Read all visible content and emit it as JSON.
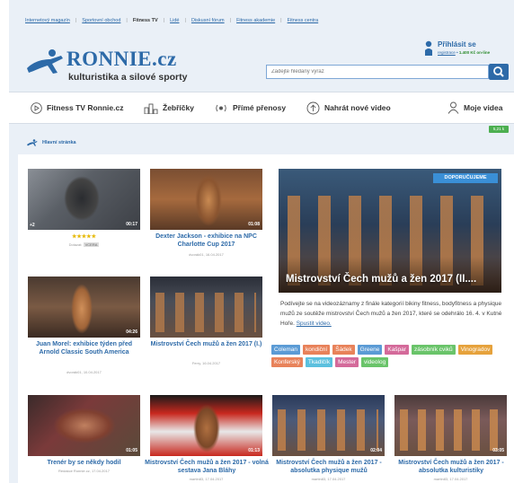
{
  "top_links": [
    {
      "label": "Internetový magazín",
      "active": false
    },
    {
      "label": "Sportovní obchod",
      "active": false
    },
    {
      "label": "Fitness TV",
      "active": true
    },
    {
      "label": "Lidé",
      "active": false
    },
    {
      "label": "Diskusní fórum",
      "active": false
    },
    {
      "label": "Fitness akademie",
      "active": false
    },
    {
      "label": "Fitness centra",
      "active": false
    }
  ],
  "header": {
    "logo_text": "RONNIE.cz",
    "logo_subtitle": "kulturistika a silové sporty",
    "login_title": "Přihlásit se",
    "login_register": "registrace",
    "login_bonus": "1.400 Kč on-line"
  },
  "search": {
    "placeholder": "Zadejte hledaný výraz"
  },
  "nav": {
    "items": [
      {
        "label": "Fitness TV Ronnie.cz",
        "icon": "play-icon"
      },
      {
        "label": "Žebříčky",
        "icon": "ranking-icon"
      },
      {
        "label": "Přímé přenosy",
        "icon": "live-icon"
      },
      {
        "label": "Nahrát nové video",
        "icon": "upload-icon"
      },
      {
        "label": "Moje videa",
        "icon": "user-icon"
      }
    ],
    "badge": "5,21 k"
  },
  "breadcrumb": {
    "label": "Hlavní stránka"
  },
  "videos": [
    {
      "title": "",
      "stars": "★★★★★",
      "meta_author": "Dotazat:",
      "meta_tag": "VCERA",
      "duration": "00:17",
      "count": "+2"
    },
    {
      "title": "Dexter Jackson - exhibice na NPC Charlotte Cup 2017",
      "meta": "dvorák01, 16.04.2017",
      "duration": "01:08"
    },
    {
      "title": "Juan Morel: exhibice týden před Arnold Classic South America",
      "meta": "dvorák01, 10.04.2017",
      "duration": "04:26"
    },
    {
      "title": "Mistrovství Čech mužů a žen 2017 (I.)",
      "meta": "Ferry, 16.04.2017",
      "duration": ""
    },
    {
      "title": "Trenér by se někdy hodil",
      "meta": "Redakce Ronnie.cz, 17.04.2017",
      "duration": "01:05"
    },
    {
      "title": "Mistrovství Čech mužů a žen 2017 - volná sestava Jana Bláhy",
      "meta": "martin83, 17.04.2017",
      "duration": "01:13"
    },
    {
      "title": "Mistrovství Čech mužů a žen 2017 - absolutka physique mužů",
      "meta": "martin83, 17.04.2017",
      "duration": "02:04"
    },
    {
      "title": "Mistrovství Čech mužů a žen 2017 - absolutka kulturistiky",
      "meta": "martin83, 17.04.2017",
      "duration": "03:05"
    }
  ],
  "featured": {
    "tag": "DOPORUČUJEME",
    "title": "Mistrovství Čech mužů a žen 2017 (II....",
    "description": "Podívejte se na videozáznamy z finále kategorií bikiny fitness, bodyfitness a physique mužů ze soutěže mistrovství Čech mužů a žen 2017, které se odehrálo 16. 4. v Kutné Hoře.",
    "link": "Spustit video."
  },
  "tags": [
    {
      "label": "Coleman",
      "color": "#5b9bd5"
    },
    {
      "label": "kondiční",
      "color": "#e8825a"
    },
    {
      "label": "Šádek",
      "color": "#e8825a"
    },
    {
      "label": "Greene",
      "color": "#5b9bd5"
    },
    {
      "label": "Kašpar",
      "color": "#d46a9a"
    },
    {
      "label": "zásobník cviků",
      "color": "#6ac46a"
    },
    {
      "label": "Vinogradov",
      "color": "#e6a23c"
    },
    {
      "label": "Konferský",
      "color": "#e8825a"
    },
    {
      "label": "Tkadlčík",
      "color": "#5bc0de"
    },
    {
      "label": "Mester",
      "color": "#d46a9a"
    },
    {
      "label": "videolog",
      "color": "#6ac46a"
    }
  ]
}
